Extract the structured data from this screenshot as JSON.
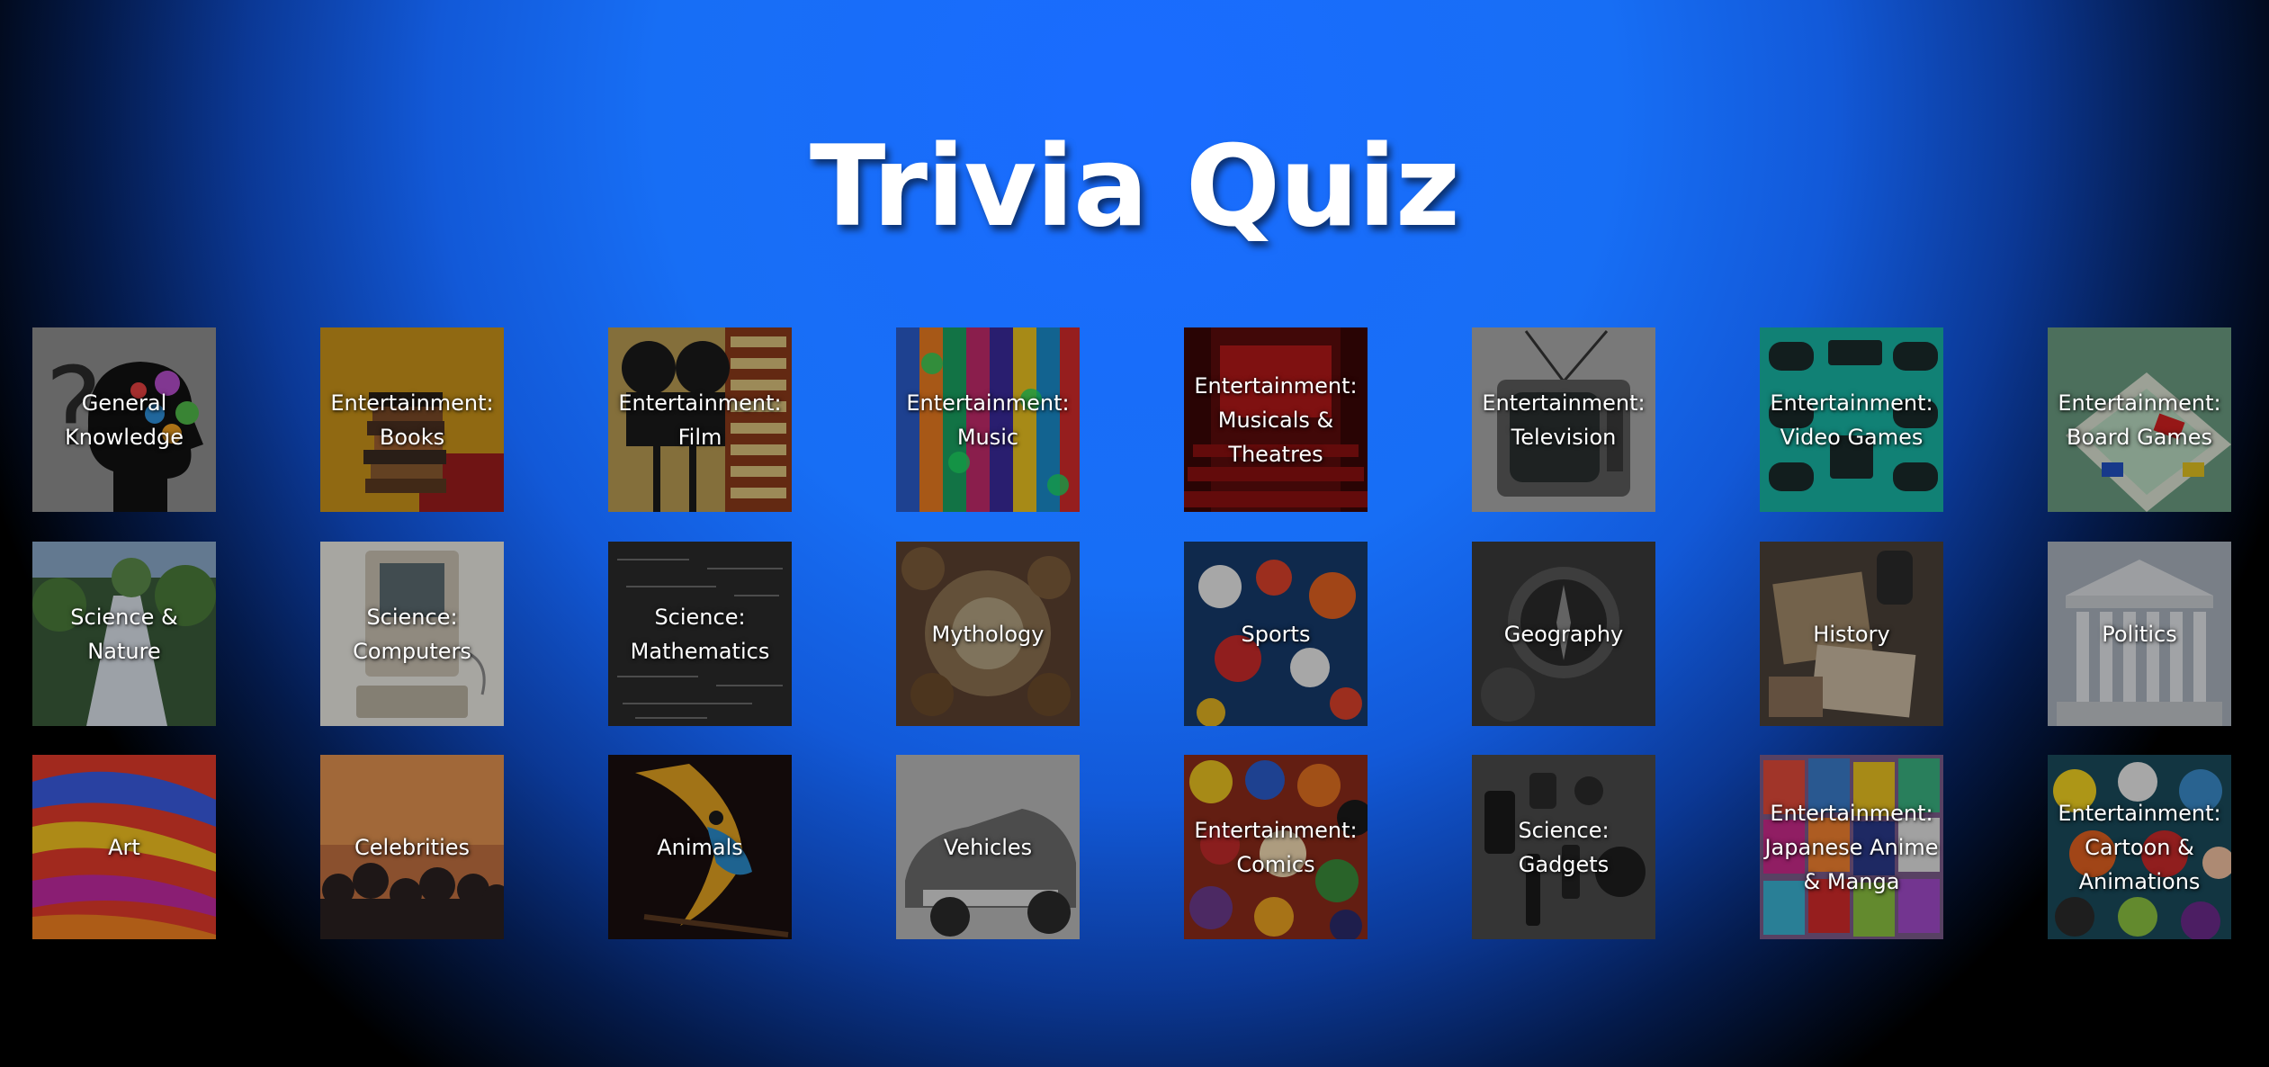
{
  "page": {
    "title": "Trivia Quiz",
    "background_color": "#1a6cff"
  },
  "categories": [
    {
      "label": "General Knowledge",
      "image": "head-gears-question-mark",
      "color": "#8a8a8a"
    },
    {
      "label": "Entertainment: Books",
      "image": "stack-of-books",
      "color": "#b8860b"
    },
    {
      "label": "Entertainment: Film",
      "image": "film-projector",
      "color": "#a08040"
    },
    {
      "label": "Entertainment: Music",
      "image": "colorful-music-app-logos",
      "color": "#cc4422"
    },
    {
      "label": "Entertainment: Musicals & Theatres",
      "image": "theatre-seats-red-curtain",
      "color": "#6a1010"
    },
    {
      "label": "Entertainment: Television",
      "image": "vintage-television",
      "color": "#9a9a9a"
    },
    {
      "label": "Entertainment: Video Games",
      "image": "game-controllers",
      "color": "#1fb5a5"
    },
    {
      "label": "Entertainment: Board Games",
      "image": "monopoly-board",
      "color": "#5a8a70"
    },
    {
      "label": "Science & Nature",
      "image": "waterfall-forest",
      "color": "#4a6a4a"
    },
    {
      "label": "Science: Computers",
      "image": "vintage-computer",
      "color": "#d8d4cc"
    },
    {
      "label": "Science: Mathematics",
      "image": "chalkboard-equations",
      "color": "#2a2a2a"
    },
    {
      "label": "Mythology",
      "image": "mythology-painting",
      "color": "#6a5040"
    },
    {
      "label": "Sports",
      "image": "sports-balls",
      "color": "#1a3a6a"
    },
    {
      "label": "Geography",
      "image": "compass",
      "color": "#3a3a3a"
    },
    {
      "label": "History",
      "image": "old-letters-and-photos",
      "color": "#6a5a48"
    },
    {
      "label": "Politics",
      "image": "supreme-court-building",
      "color": "#9aa0a8"
    },
    {
      "label": "Art",
      "image": "paint-strokes",
      "color": "#e0402a"
    },
    {
      "label": "Celebrities",
      "image": "concert-crowd",
      "color": "#7a5a4a"
    },
    {
      "label": "Animals",
      "image": "parrot",
      "color": "#1a1010"
    },
    {
      "label": "Vehicles",
      "image": "vintage-car",
      "color": "#8a8a8a"
    },
    {
      "label": "Entertainment: Comics",
      "image": "anime-comic-collage",
      "color": "#8a2a1a"
    },
    {
      "label": "Science: Gadgets",
      "image": "gadgets-flatlay",
      "color": "#4a4a4a"
    },
    {
      "label": "Entertainment: Japanese Anime & Manga",
      "image": "manga-books",
      "color": "#7a5a8a"
    },
    {
      "label": "Entertainment: Cartoon & Animations",
      "image": "cartoon-collage",
      "color": "#2a6a6a"
    }
  ]
}
